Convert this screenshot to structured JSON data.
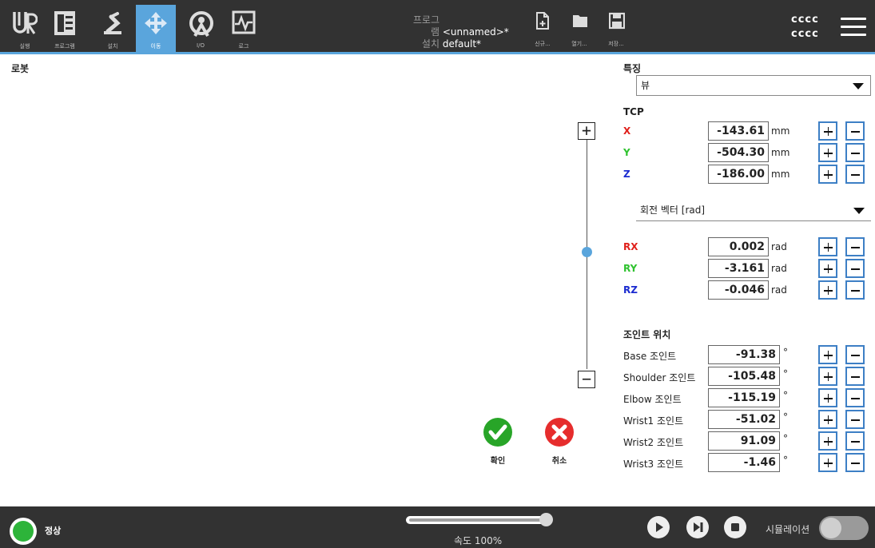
{
  "header": {
    "nav": [
      {
        "id": "run",
        "label": "실행",
        "icon": "ur-logo-icon"
      },
      {
        "id": "program",
        "label": "프로그램",
        "icon": "program-icon"
      },
      {
        "id": "installation",
        "label": "설치",
        "icon": "robot-arm-icon"
      },
      {
        "id": "move",
        "label": "이동",
        "icon": "move-arrows-icon",
        "active": true
      },
      {
        "id": "io",
        "label": "I/O",
        "icon": "io-icon"
      },
      {
        "id": "log",
        "label": "로그",
        "icon": "log-icon"
      }
    ],
    "program_key": "프로그램",
    "program_value": "<unnamed>*",
    "installation_key": "설치",
    "installation_value": "default*",
    "file_buttons": [
      {
        "label": "신규...",
        "icon": "new-file-icon"
      },
      {
        "label": "열기...",
        "icon": "folder-icon"
      },
      {
        "label": "저장...",
        "icon": "save-icon"
      }
    ],
    "user_line1": "cccc",
    "user_line2": "cccc"
  },
  "left": {
    "title": "로봇",
    "confirm_label": "확인",
    "cancel_label": "취소"
  },
  "right": {
    "feature_title": "특징",
    "feature_value": "뷰",
    "tcp_title": "TCP",
    "tcp": [
      {
        "axis": "X",
        "value": "-143.61",
        "unit": "mm",
        "color": "#e0201b"
      },
      {
        "axis": "Y",
        "value": "-504.30",
        "unit": "mm",
        "color": "#2fc22f"
      },
      {
        "axis": "Z",
        "value": "-186.00",
        "unit": "mm",
        "color": "#1b2bd0"
      }
    ],
    "rotation_value": "회전 벡터 [rad]",
    "rotation": [
      {
        "axis": "RX",
        "value": "0.002",
        "unit": "rad",
        "color": "#e0201b"
      },
      {
        "axis": "RY",
        "value": "-3.161",
        "unit": "rad",
        "color": "#2fc22f"
      },
      {
        "axis": "RZ",
        "value": "-0.046",
        "unit": "rad",
        "color": "#1b2bd0"
      }
    ],
    "joints_title": "조인트 위치",
    "joints": [
      {
        "label": "Base 조인트",
        "value": "-91.38",
        "unit": "°"
      },
      {
        "label": "Shoulder 조인트",
        "value": "-105.48",
        "unit": "°"
      },
      {
        "label": "Elbow 조인트",
        "value": "-115.19",
        "unit": "°"
      },
      {
        "label": "Wrist1 조인트",
        "value": "-51.02",
        "unit": "°"
      },
      {
        "label": "Wrist2 조인트",
        "value": "91.09",
        "unit": "°"
      },
      {
        "label": "Wrist3 조인트",
        "value": "-1.46",
        "unit": "°"
      }
    ]
  },
  "footer": {
    "status": "정상",
    "speed_label": "속도 100%",
    "speed_percent": 100,
    "sim_label": "시뮬레이션",
    "sim_on": false
  }
}
